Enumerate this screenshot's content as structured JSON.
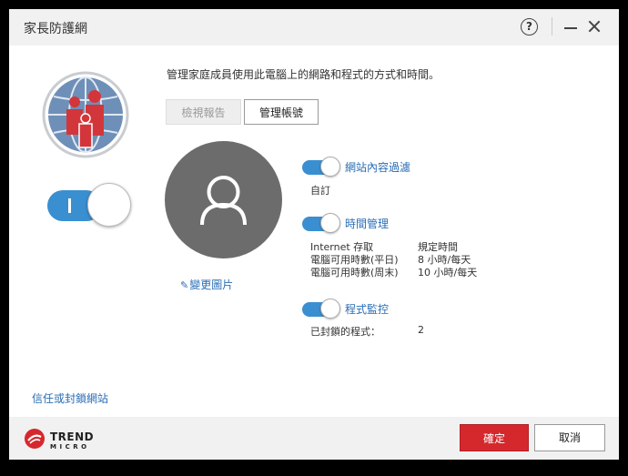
{
  "window": {
    "title": "家長防護網",
    "help_label": "?"
  },
  "left": {
    "trust_link": "信任或封鎖網站"
  },
  "main": {
    "description": "管理家庭成員使用此電腦上的網路和程式的方式和時間。",
    "tabs": [
      {
        "label": "檢視報告",
        "state": "disabled"
      },
      {
        "label": "管理帳號",
        "state": "active"
      }
    ],
    "change_picture": "變更圖片"
  },
  "sections": {
    "web_filter": {
      "title": "網站內容過濾",
      "enabled": true,
      "value": "自訂"
    },
    "time_mgmt": {
      "title": "時間管理",
      "enabled": true,
      "rows": [
        {
          "label": "Internet 存取",
          "value": "規定時間"
        },
        {
          "label": "電腦可用時數(平日)",
          "value": "8 小時/每天"
        },
        {
          "label": "電腦可用時數(周末)",
          "value": "10 小時/每天"
        }
      ]
    },
    "program_ctrl": {
      "title": "程式監控",
      "enabled": true,
      "rows": [
        {
          "label": "已封鎖的程式：",
          "value": "2"
        }
      ]
    }
  },
  "footer": {
    "brand_line1": "TREND",
    "brand_line2": "MICRO",
    "ok_label": "確定",
    "cancel_label": "取消"
  },
  "colors": {
    "accent_blue": "#3a8fd1",
    "link_blue": "#2a6db5",
    "ok_red": "#d5282d",
    "globe_red": "#d3363a"
  }
}
